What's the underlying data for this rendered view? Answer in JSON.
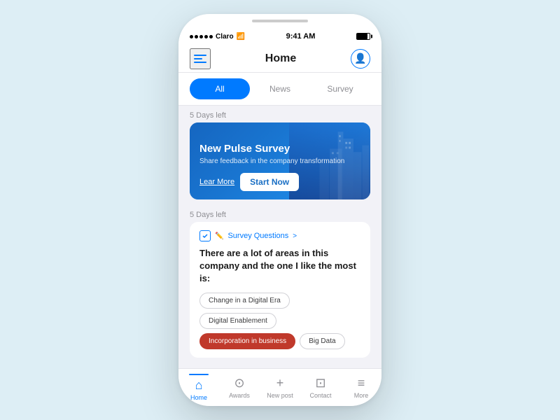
{
  "phone": {
    "status_bar": {
      "carrier": "Claro",
      "signal_dots": 5,
      "time": "9:41 AM"
    },
    "nav": {
      "title": "Home",
      "menu_label": "menu",
      "avatar_label": "profile"
    },
    "tabs": [
      {
        "id": "all",
        "label": "All",
        "active": true
      },
      {
        "id": "news",
        "label": "News",
        "active": false
      },
      {
        "id": "survey",
        "label": "Survey",
        "active": false
      }
    ],
    "sections": [
      {
        "id": "pulse-section",
        "days_left": "5 Days left",
        "card_type": "banner",
        "card": {
          "title": "New Pulse Survey",
          "subtitle": "Share feedback in the company transformation",
          "learn_more_label": "Lear More",
          "start_now_label": "Start Now"
        }
      },
      {
        "id": "question-section",
        "days_left": "5 Days left",
        "card_type": "question",
        "meta_label": "Survey Questions",
        "meta_arrow": ">",
        "question_text": "There are a lot of areas in this company and the one I like the most is:",
        "options": [
          {
            "id": "opt1",
            "label": "Change in a Digital Era",
            "selected": false
          },
          {
            "id": "opt2",
            "label": "Digital Enablement",
            "selected": false
          },
          {
            "id": "opt3",
            "label": "Incorporation in business",
            "selected": true
          },
          {
            "id": "opt4",
            "label": "Big Data",
            "selected": false
          }
        ]
      }
    ],
    "bottom_nav": [
      {
        "id": "home",
        "label": "Home",
        "icon": "🏠",
        "active": true
      },
      {
        "id": "awards",
        "label": "Awards",
        "icon": "⭐",
        "active": false
      },
      {
        "id": "new-post",
        "label": "New post",
        "icon": "+",
        "active": false
      },
      {
        "id": "contact",
        "label": "Contact",
        "icon": "💬",
        "active": false
      },
      {
        "id": "more",
        "label": "More",
        "icon": "☰",
        "active": false
      }
    ]
  }
}
